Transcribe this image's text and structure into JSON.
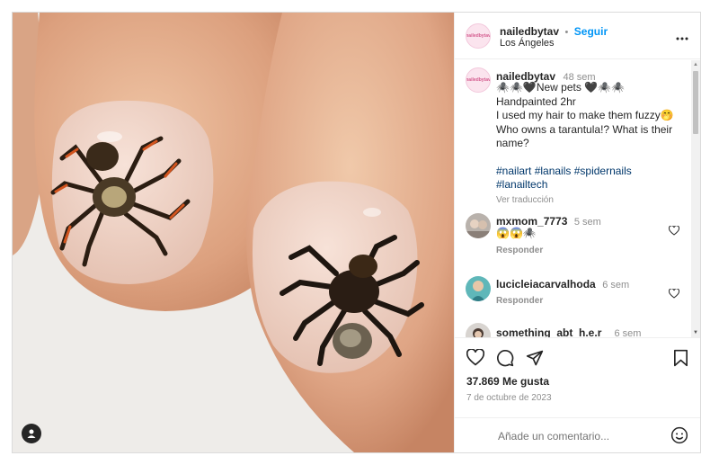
{
  "post": {
    "author": {
      "username": "nailedbytav",
      "separator": "•",
      "follow_label": "Seguir",
      "location": "Los Ángeles",
      "avatar_text": "nailedbytav"
    },
    "more_icon": "more-horizontal-icon",
    "caption": {
      "username": "nailedbytav",
      "age": "48 sem",
      "line1": "🕷️🕷️🖤New pets 🖤🕷️🕷️",
      "line2": "Handpainted 2hr",
      "line3": "I used my hair to make them fuzzy🤭",
      "line4": "Who owns a tarantula!? What is their name?",
      "hashtags": "#nailart #lanails #spidernails #lanailtech",
      "translate_label": "Ver traducción"
    },
    "comments": [
      {
        "username": "mxmom_7773",
        "age": "5 sem",
        "text": "😱😱🕷️",
        "reply_label": "Responder"
      },
      {
        "username": "lucicleiacarvalhoda",
        "age": "6 sem",
        "text": "",
        "reply_label": "Responder"
      },
      {
        "username": "something_abt_h.e.r_",
        "age": "6 sem",
        "text": "",
        "reply_label": ""
      }
    ],
    "likes": "37.869 Me gusta",
    "date": "7 de octubre de 2023",
    "add_comment_placeholder": "Añade un comentario...",
    "colors": {
      "link": "#0095f6",
      "hashtag": "#00376b",
      "muted": "#8e8e8e",
      "text": "#262626"
    }
  }
}
